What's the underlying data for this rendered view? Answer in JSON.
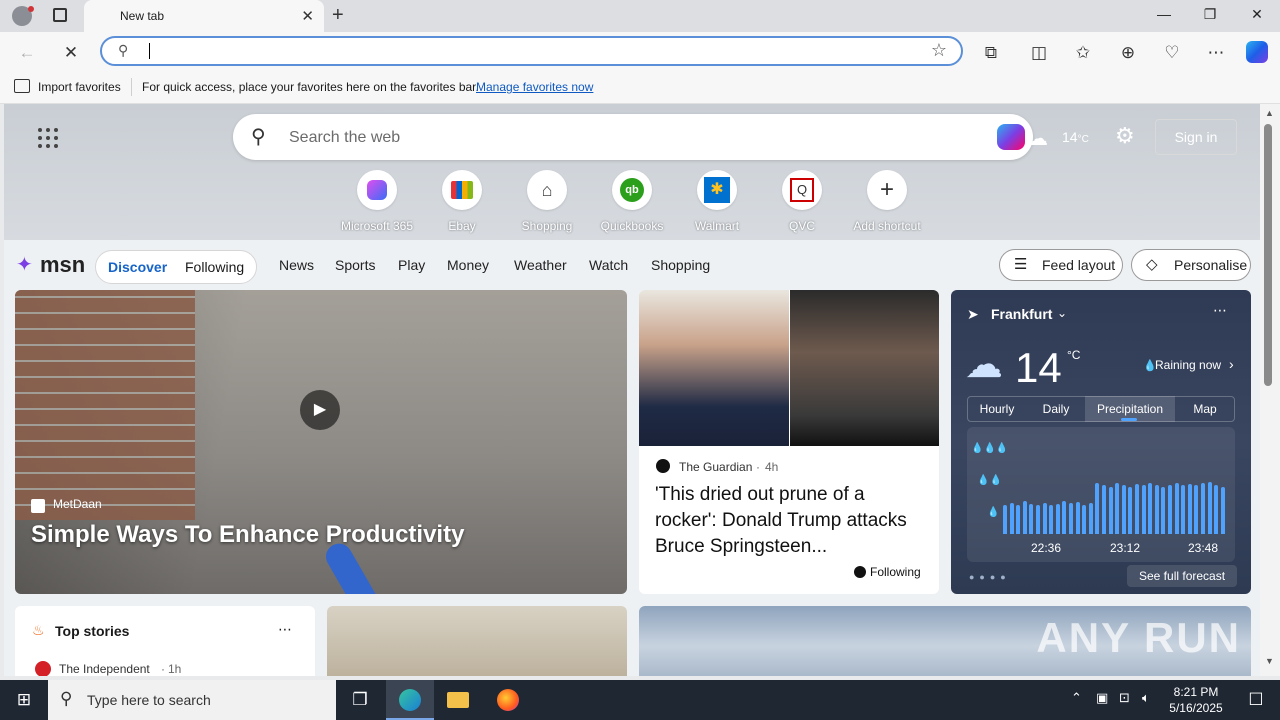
{
  "browser": {
    "tab_title": "New tab",
    "address_value": ""
  },
  "favorites_bar": {
    "import_label": "Import favorites",
    "message": "For quick access, place your favorites here on the favorites bar.",
    "manage_link": "Manage favorites now"
  },
  "hero": {
    "search_placeholder": "Search the web",
    "temperature": "14",
    "temperature_unit": "°C",
    "signin_label": "Sign in",
    "shortcuts": [
      {
        "label": "Microsoft 365",
        "color": "#5b6df5"
      },
      {
        "label": "Ebay",
        "color": "#222222"
      },
      {
        "label": "Shopping",
        "color": "#444444"
      },
      {
        "label": "Quickbooks",
        "color": "#2ca01c"
      },
      {
        "label": "Walmart",
        "color": "#0071ce"
      },
      {
        "label": "QVC",
        "color": "#c00000"
      },
      {
        "label": "Add shortcut",
        "color": "#444444"
      }
    ]
  },
  "msn_nav": {
    "logo": "msn",
    "discover": "Discover",
    "following": "Following",
    "links": [
      "News",
      "Sports",
      "Play",
      "Money",
      "Weather",
      "Watch",
      "Shopping"
    ],
    "feed_layout": "Feed layout",
    "personalise": "Personalise"
  },
  "main_story": {
    "source": "MetDaan",
    "headline": "Simple Ways To Enhance Productivity"
  },
  "story2": {
    "source": "The Guardian",
    "age": "4h",
    "headline": "'This dried out prune of a rocker': Donald Trump attacks Bruce Springsteen...",
    "following_label": "Following"
  },
  "weather": {
    "city": "Frankfurt",
    "temp": "14",
    "unit": "°C",
    "condition": "Raining now",
    "tabs": [
      "Hourly",
      "Daily",
      "Precipitation",
      "Map"
    ],
    "active_tab": "Precipitation",
    "times": [
      "22:36",
      "23:12",
      "23:48"
    ],
    "forecast_link": "See full forecast",
    "bar_levels": [
      0.35,
      0.38,
      0.36,
      0.4,
      0.37,
      0.36,
      0.38,
      0.35,
      0.37,
      0.4,
      0.38,
      0.39,
      0.36,
      0.38,
      0.62,
      0.6,
      0.58,
      0.62,
      0.6,
      0.58,
      0.61,
      0.6,
      0.62,
      0.6,
      0.58,
      0.6,
      0.62,
      0.6,
      0.61,
      0.6,
      0.62,
      0.64,
      0.6,
      0.58
    ]
  },
  "top_stories": {
    "title": "Top stories",
    "source": "The Independent",
    "age": "1h"
  },
  "watermark": "ANY RUN",
  "taskbar": {
    "search_placeholder": "Type here to search",
    "time": "8:21 PM",
    "date": "5/16/2025"
  }
}
